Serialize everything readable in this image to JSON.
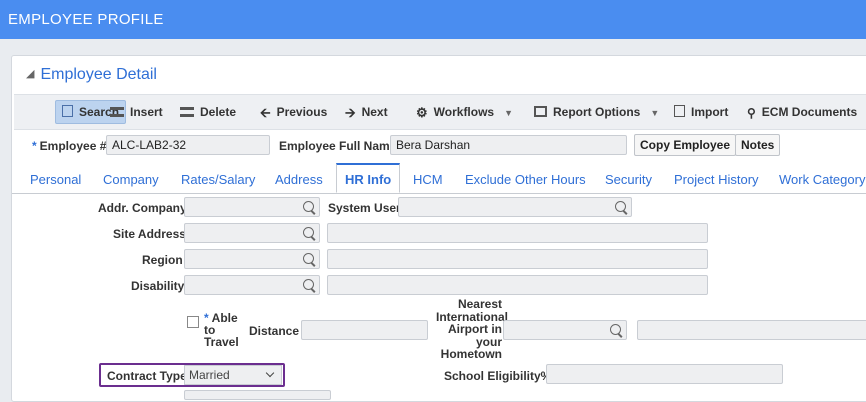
{
  "header": {
    "title": "EMPLOYEE PROFILE"
  },
  "section": {
    "title": "Employee Detail"
  },
  "toolbar": {
    "search": "Search",
    "insert": "Insert",
    "delete": "Delete",
    "previous": "Previous",
    "next": "Next",
    "workflows": "Workflows",
    "report_options": "Report Options",
    "import": "Import",
    "ecm_documents": "ECM Documents"
  },
  "employee": {
    "id_label": "Employee #",
    "id_value": "ALC-LAB2-32",
    "name_label": "Employee Full Name",
    "name_value": "Bera Darshan",
    "copy_button": "Copy Employee",
    "notes_button": "Notes"
  },
  "tabs": [
    "Personal",
    "Company",
    "Rates/Salary",
    "Address",
    "HR Info",
    "HCM",
    "Exclude Other Hours",
    "Security",
    "Project History",
    "Work Category"
  ],
  "active_tab": "HR Info",
  "form": {
    "addr_company": "Addr. Company",
    "system_user": "System User",
    "site_address": "Site Address",
    "region": "Region",
    "disability": "Disability",
    "able_to_travel": "Able to Travel",
    "able_line1": "Able",
    "able_line2": "to",
    "able_line3": "Travel",
    "distance": "Distance",
    "airport_l1": "Nearest",
    "airport_l2": "International",
    "airport_l3": "Airport in",
    "airport_l4": "your",
    "airport_l5": "Hometown",
    "contract_type": "Contract Type",
    "contract_type_value": "Married",
    "school_eligibility": "School Eligibility%"
  },
  "colors": {
    "header_bg": "#4a8df0",
    "accent": "#2f6fd6",
    "highlight_border": "#6b2e8f"
  }
}
